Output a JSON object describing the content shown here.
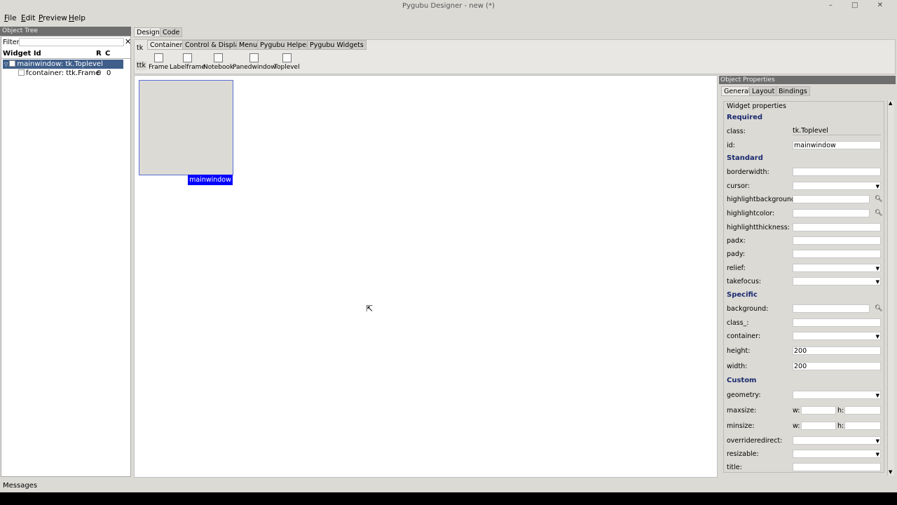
{
  "window": {
    "title": "Pygubu Designer - new (*)",
    "controls": "– □ ✕"
  },
  "menubar": [
    "File",
    "Edit",
    "Preview",
    "Help"
  ],
  "object_tree": {
    "header": "Object Tree",
    "filter_label": "Filter:",
    "filter_value": "",
    "clear_label": "✕",
    "columns": [
      "Widget Id",
      "R",
      "C"
    ],
    "rows": [
      {
        "label": "mainwindow: tk.Toplevel",
        "r": "",
        "c": ""
      },
      {
        "label": "fcontainer: ttk.Frame",
        "r": "0",
        "c": "0"
      }
    ]
  },
  "main_tabs": [
    "Design",
    "Code"
  ],
  "palette": {
    "sides": [
      "tk",
      "ttk"
    ],
    "groups": [
      "Containers",
      "Control & Display",
      "Menu",
      "Pygubu Helpers",
      "Pygubu Widgets"
    ],
    "items": [
      "Frame",
      "Labelframe",
      "Notebook",
      "Panedwindow",
      "Toplevel"
    ]
  },
  "preview": {
    "label": "mainwindow"
  },
  "properties": {
    "header": "Object Properties",
    "tabs": [
      "General",
      "Layout",
      "Bindings"
    ],
    "group": "Widget properties",
    "required": {
      "title": "Required",
      "class_label": "class:",
      "class_value": "tk.Toplevel",
      "id_label": "id:",
      "id_value": "mainwindow"
    },
    "standard": {
      "title": "Standard",
      "labels": [
        "borderwidth:",
        "cursor:",
        "highlightbackground:",
        "highlightcolor:",
        "highlightthickness:",
        "padx:",
        "pady:",
        "relief:",
        "takefocus:"
      ]
    },
    "specific": {
      "title": "Specific",
      "labels": [
        "background:",
        "class_:",
        "container:",
        "height:",
        "width:"
      ],
      "height_value": "200",
      "width_value": "200"
    },
    "custom": {
      "title": "Custom",
      "labels": [
        "geometry:",
        "maxsize:",
        "minsize:",
        "overrideredirect:",
        "resizable:",
        "title:"
      ],
      "w_label": "w:",
      "h_label": "h:"
    }
  },
  "status": {
    "text": "Messages"
  }
}
